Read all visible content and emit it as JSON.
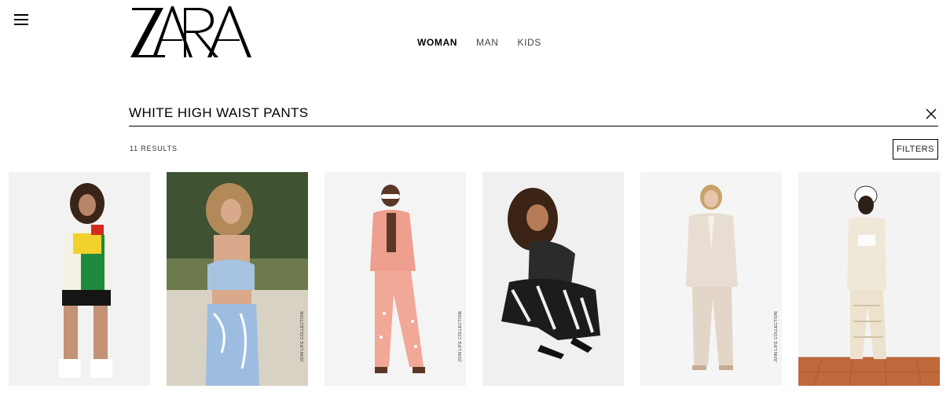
{
  "header": {
    "menu_icon": "hamburger-menu-icon",
    "logo_text": "ZARA",
    "nav": [
      {
        "label": "WOMAN",
        "active": true
      },
      {
        "label": "MAN",
        "active": false
      },
      {
        "label": "KIDS",
        "active": false
      }
    ]
  },
  "search": {
    "value": "WHITE HIGH WAIST PANTS",
    "clear_icon": "close-icon"
  },
  "results": {
    "count_text": "11 RESULTS",
    "filters_label": "FILTERS"
  },
  "products": [
    {
      "image": "woman in white sweater with green and red panels and black bike shorts",
      "label": ""
    },
    {
      "image": "woman in blue printed bustier top and matching pants outdoors",
      "label": "JOIN LIFE COLLECTION"
    },
    {
      "image": "model in pink polka-dot suit with wide-leg pants",
      "label": "JOIN LIFE COLLECTION"
    },
    {
      "image": "woman crouching in black and white zebra print set",
      "label": ""
    },
    {
      "image": "woman in beige double-breasted blazer and trousers",
      "label": "JOIN LIFE COLLECTION"
    },
    {
      "image": "model in crochet white top and pants on terracotta floor",
      "label": ""
    }
  ],
  "colors": {
    "accent": "#000000",
    "background": "#ffffff"
  }
}
